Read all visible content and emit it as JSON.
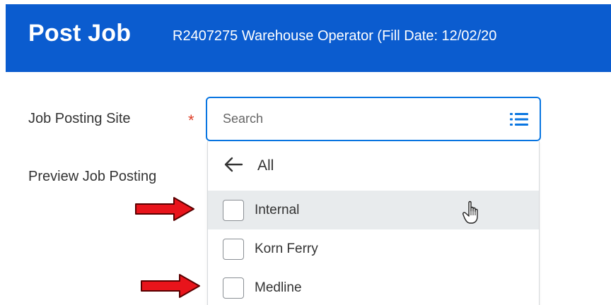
{
  "header": {
    "title": "Post Job",
    "subtitle": "R2407275 Warehouse Operator (Fill Date: 12/02/20"
  },
  "form": {
    "job_posting_site_label": "Job Posting Site",
    "required_marker": "*",
    "preview_label": "Preview Job Posting",
    "search": {
      "placeholder": "Search",
      "icon": "list-icon"
    }
  },
  "dropdown": {
    "back_label": "All",
    "options": [
      {
        "label": "Internal",
        "checked": false,
        "hovered": true
      },
      {
        "label": "Korn Ferry",
        "checked": false,
        "hovered": false
      },
      {
        "label": "Medline",
        "checked": false,
        "hovered": false
      }
    ]
  },
  "colors": {
    "header_bg": "#0b5ccf",
    "focus_border": "#0875e1",
    "required": "#de3a23",
    "hover_row": "#e8ebed",
    "annotation_arrow": "#e8141b"
  }
}
